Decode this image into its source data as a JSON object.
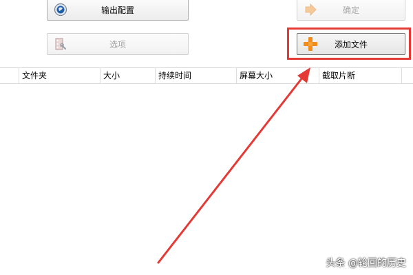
{
  "toolbar": {
    "output_config_label": "输出配置",
    "confirm_label": "确定",
    "options_label": "选项",
    "add_file_label": "添加文件"
  },
  "file_table": {
    "columns": [
      "文件夹",
      "大小",
      "持续时间",
      "屏幕大小",
      "截取片断"
    ],
    "rows": []
  },
  "annotation": {
    "highlight_color": "#e53935"
  },
  "watermark": {
    "text": "头条 @轮回的历史"
  }
}
